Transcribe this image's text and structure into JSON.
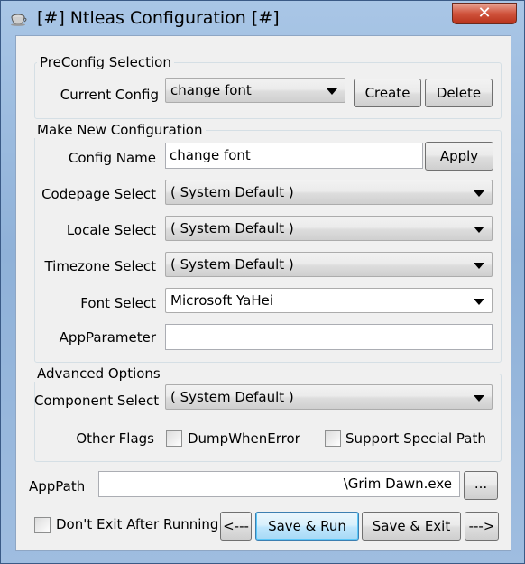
{
  "window": {
    "title": "[#] Ntleas Configuration [#]",
    "close_glyph": "✕"
  },
  "preconfig": {
    "group_title": "PreConfig Selection",
    "current_config_label": "Current Config",
    "current_config_value": "change font",
    "create_label": "Create",
    "delete_label": "Delete"
  },
  "new_config": {
    "group_title": "Make New Configuration",
    "config_name_label": "Config Name",
    "config_name_value": "change font",
    "apply_label": "Apply",
    "codepage_label": "Codepage Select",
    "codepage_value": "( System Default )",
    "locale_label": "Locale Select",
    "locale_value": "( System Default )",
    "timezone_label": "Timezone Select",
    "timezone_value": "( System Default )",
    "font_label": "Font Select",
    "font_value": "Microsoft YaHei",
    "appparam_label": "AppParameter",
    "appparam_value": ""
  },
  "advanced": {
    "group_title": "Advanced Options",
    "component_label": "Component Select",
    "component_value": "( System Default )",
    "other_flags_label": "Other Flags",
    "dump_label": "DumpWhenError",
    "dump_checked": false,
    "special_path_label": "Support Special Path",
    "special_path_checked": false
  },
  "apppath": {
    "label": "AppPath",
    "value": "\\Grim Dawn.exe",
    "browse_label": "..."
  },
  "footer": {
    "dont_exit_label": "Don't Exit After Running",
    "dont_exit_checked": false,
    "prev_label": "<---",
    "save_run_label": "Save & Run",
    "save_exit_label": "Save & Exit",
    "next_label": "--->"
  }
}
